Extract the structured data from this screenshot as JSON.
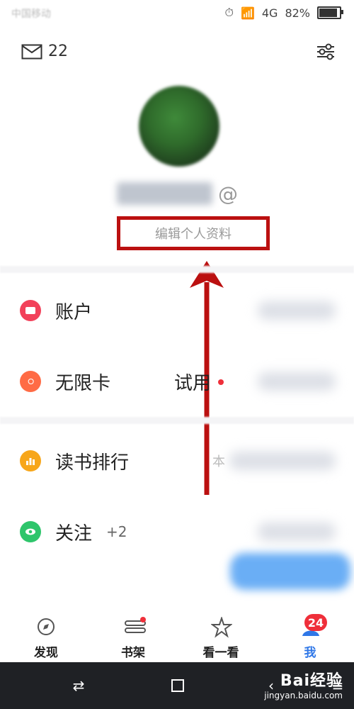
{
  "status_bar": {
    "left_text": "中国移动",
    "network": "4G",
    "battery_percent": "82%",
    "battery_level": 0.82
  },
  "header": {
    "mail_count": "22",
    "mail_icon": "mail-icon",
    "settings_icon": "sliders-icon"
  },
  "profile": {
    "username_suffix": "@",
    "edit_profile_label": "编辑个人资料"
  },
  "menu": {
    "items": [
      {
        "label": "账户",
        "icon": "wallet-icon",
        "color": "#f2415a"
      },
      {
        "label": "无限卡",
        "label_tail": "试用",
        "icon": "card-icon",
        "color": "#ff6b45"
      },
      {
        "label": "读书排行",
        "note": "本",
        "icon": "bar-chart-icon",
        "color": "#f7a61a"
      },
      {
        "label": "关注",
        "extra": "+2",
        "icon": "eye-icon",
        "color": "#2ec56b"
      }
    ]
  },
  "bottom_nav": {
    "tabs": [
      {
        "label": "发现",
        "icon": "compass-icon"
      },
      {
        "label": "书架",
        "icon": "bookshelf-icon"
      },
      {
        "label": "看一看",
        "icon": "star-icon"
      },
      {
        "label": "我",
        "icon": "person-icon",
        "badge": "24",
        "active_color": "#2f77e7"
      }
    ]
  },
  "watermark": {
    "brand": "Bai经验",
    "url": "jingyan.baidu.com"
  },
  "accent": {
    "highlight_red": "#bb1010",
    "badge_red": "#ef2f3a"
  }
}
